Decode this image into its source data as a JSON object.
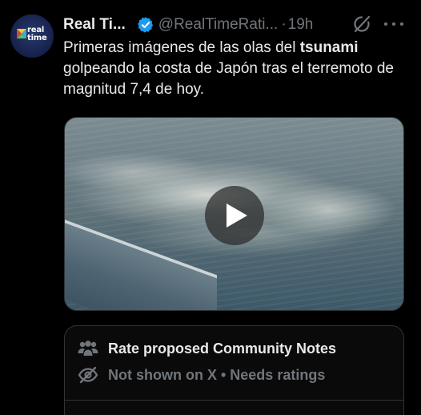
{
  "account": {
    "avatar_text_line1": "real",
    "avatar_text_line2": "time",
    "display_name": "Real Ti...",
    "handle": "@RealTimeRati...",
    "separator": "·",
    "time": "19h"
  },
  "tweet": {
    "text_before": "Primeras imágenes de las olas del ",
    "text_bold": "tsunami",
    "text_after": " golpeando la costa de Japón tras el terremoto de magnitud 7,4 de hoy."
  },
  "community_notes": {
    "title": "Rate proposed Community Notes",
    "status": "Not shown on X • Needs ratings"
  },
  "icons": {
    "verified": "verified-badge-icon",
    "grok": "grok-icon",
    "more": "more-icon",
    "play": "play-icon",
    "people": "people-icon",
    "eye_off": "eye-off-icon"
  },
  "colors": {
    "background": "#000000",
    "text": "#e7e9ea",
    "secondary": "#71767b",
    "verified": "#1d9bf0",
    "border": "#2f3336"
  }
}
